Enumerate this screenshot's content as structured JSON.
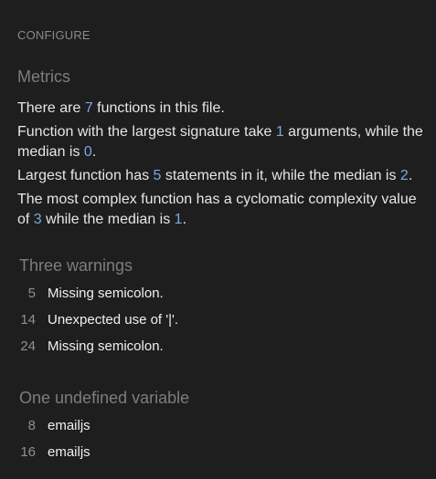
{
  "configure_label": "CONFIGURE",
  "metrics": {
    "heading": "Metrics",
    "line1": {
      "pre": "There are ",
      "num": "7",
      "post": " functions in this file."
    },
    "line2": {
      "pre": "Function with the largest signature take ",
      "num1": "1",
      "mid": " arguments, while the median is ",
      "num2": "0",
      "post": "."
    },
    "line3": {
      "pre": "Largest function has ",
      "num1": "5",
      "mid": " statements in it, while the median is ",
      "num2": "2",
      "post": "."
    },
    "line4": {
      "pre": "The most complex function has a cyclomatic complexity value of ",
      "num1": "3",
      "mid": " while the median is ",
      "num2": "1",
      "post": "."
    }
  },
  "warnings": {
    "heading": "Three warnings",
    "items": [
      {
        "line": "5",
        "message": "Missing semicolon."
      },
      {
        "line": "14",
        "message": "Unexpected use of '|'."
      },
      {
        "line": "24",
        "message": "Missing semicolon."
      }
    ]
  },
  "undefined_variables": {
    "heading": "One undefined variable",
    "items": [
      {
        "line": "8",
        "name": "emailjs"
      },
      {
        "line": "16",
        "name": "emailjs"
      }
    ]
  },
  "colors": {
    "background": "#1e1e1e",
    "text": "#e6e6e6",
    "heading": "#7d7d7d",
    "number_accent": "#7aa7e0"
  }
}
